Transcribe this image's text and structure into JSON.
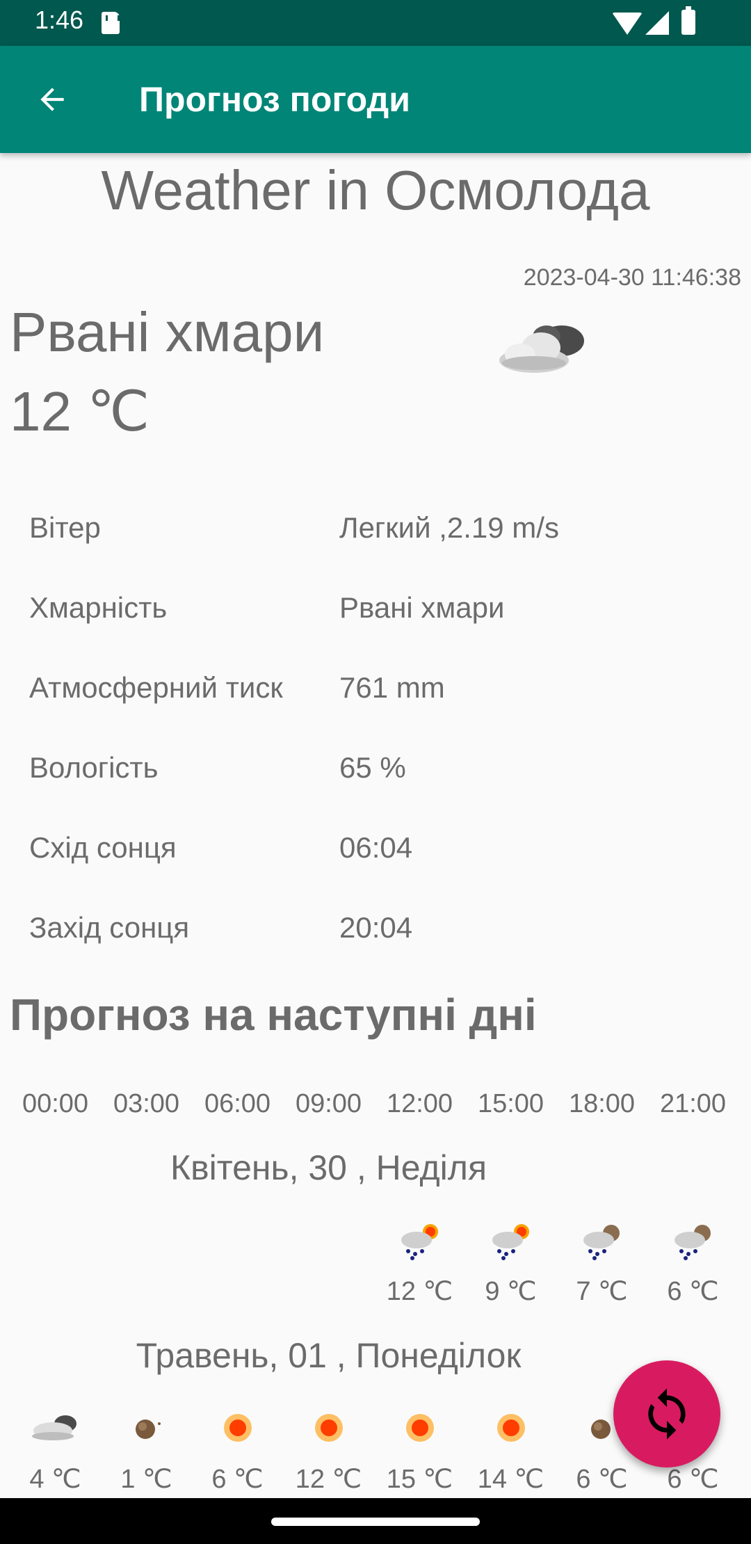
{
  "status_bar": {
    "time": "1:46",
    "icons": [
      "sd-card-icon",
      "wifi-icon",
      "signal-icon",
      "battery-icon"
    ]
  },
  "app_bar": {
    "title": "Прогноз погоди",
    "back_icon": "arrow-back-icon"
  },
  "weather": {
    "city_title": "Weather in Осмолода",
    "datetime": "2023-04-30 11:46:38",
    "description": "Рвані хмари",
    "temperature": "12 ℃",
    "icon": "broken-clouds-icon"
  },
  "details": [
    {
      "label": "Вітер",
      "value": "Легкий ,2.19 m/s"
    },
    {
      "label": "Хмарність",
      "value": "Рвані хмари"
    },
    {
      "label": "Атмосферний тиск",
      "value": "761 mm"
    },
    {
      "label": "Вологість",
      "value": "65 %"
    },
    {
      "label": "Схід сонця",
      "value": "06:04"
    },
    {
      "label": "Захід сонця",
      "value": "20:04"
    }
  ],
  "forecast": {
    "heading": "Прогноз на наступні дні",
    "hours": [
      "00:00",
      "03:00",
      "06:00",
      "09:00",
      "12:00",
      "15:00",
      "18:00",
      "21:00"
    ],
    "days": [
      {
        "title": "Квітень, 30 , Неділя",
        "entries": [
          {
            "temp": "12 ℃",
            "icon": "rain-sun-icon"
          },
          {
            "temp": "9 ℃",
            "icon": "rain-sun-icon"
          },
          {
            "temp": "7 ℃",
            "icon": "rain-night-icon"
          },
          {
            "temp": "6 ℃",
            "icon": "rain-night-icon"
          }
        ]
      },
      {
        "title": "Травень, 01 , Понеділок",
        "entries": [
          {
            "temp": "4 ℃",
            "icon": "broken-clouds-icon"
          },
          {
            "temp": "1 ℃",
            "icon": "clear-night-icon"
          },
          {
            "temp": "6 ℃",
            "icon": "sun-icon"
          },
          {
            "temp": "12 ℃",
            "icon": "sun-icon"
          },
          {
            "temp": "15 ℃",
            "icon": "sun-icon"
          },
          {
            "temp": "14 ℃",
            "icon": "sun-icon"
          },
          {
            "temp": "6 ℃",
            "icon": "clear-night-icon"
          },
          {
            "temp": "6 ℃",
            "icon": "clear-night-icon"
          }
        ]
      }
    ]
  },
  "fab": {
    "icon": "refresh-icon"
  },
  "colors": {
    "status_bar": "#00584e",
    "app_bar": "#008577",
    "fab": "#d81b60",
    "text": "#6b6b6b"
  }
}
